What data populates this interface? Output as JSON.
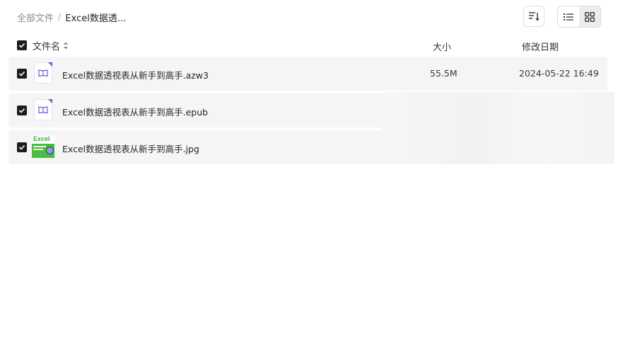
{
  "breadcrumb": {
    "root": "全部文件",
    "separator": "/",
    "current": "Excel数据透..."
  },
  "toolbar": {
    "sort_icon": "sort-icon",
    "view_list_icon": "list-view-icon",
    "view_grid_icon": "grid-view-icon"
  },
  "header": {
    "name": "文件名",
    "size": "大小",
    "date": "修改日期"
  },
  "files": [
    {
      "name": "Excel数据透视表从新手到高手.azw3",
      "size": "55.5M",
      "date": "2024-05-22 16:49",
      "icon": "ebook-icon",
      "checked": true
    },
    {
      "name": "Excel数据透视表从新手到高手.epub",
      "size": "",
      "date": "",
      "icon": "ebook-icon",
      "checked": true
    },
    {
      "name": "Excel数据透视表从新手到高手.jpg",
      "size": "",
      "date": "",
      "icon": "image-thumbnail",
      "checked": true
    }
  ],
  "thumbnail_text": "Excel",
  "colors": {
    "accent": "#6f5bd3",
    "checkbox": "#1c1c1c",
    "row_bg": "#f5f5f5",
    "thumb_green": "#4cbb45"
  }
}
